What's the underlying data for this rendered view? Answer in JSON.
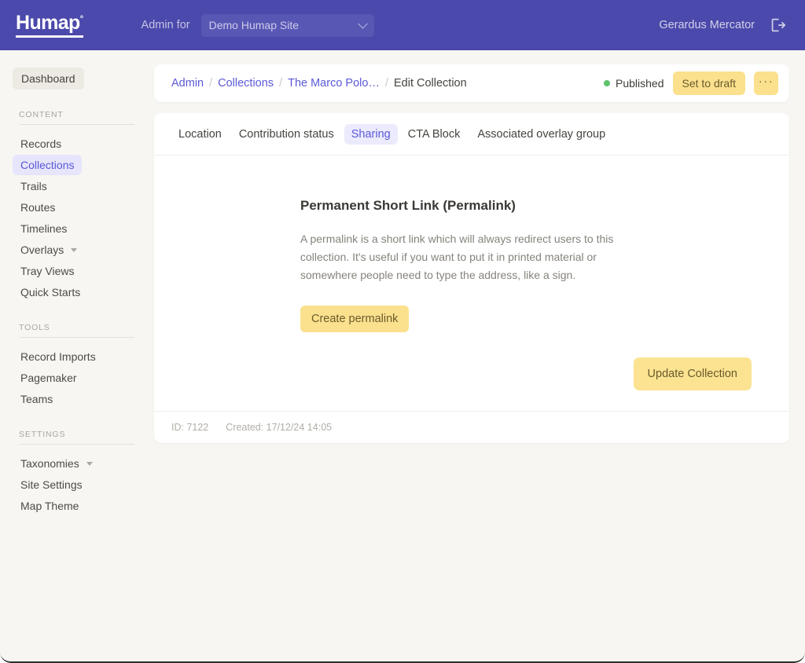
{
  "navbar": {
    "logo_text": "Humap",
    "logo_mark": "°",
    "admin_for_label": "Admin for",
    "site_select_value": "Demo Humap Site",
    "site_select_options": [
      "Demo Humap Site"
    ],
    "username": "Gerardus Mercator",
    "logout_icon": "logout-icon",
    "brand_color": "#4b49ab"
  },
  "sidebar": {
    "dashboard_label": "Dashboard",
    "groups": [
      {
        "title": "CONTENT",
        "items": [
          {
            "label": "Records",
            "active": false,
            "caret": false
          },
          {
            "label": "Collections",
            "active": true,
            "caret": false
          },
          {
            "label": "Trails",
            "active": false,
            "caret": false
          },
          {
            "label": "Routes",
            "active": false,
            "caret": false
          },
          {
            "label": "Timelines",
            "active": false,
            "caret": false
          },
          {
            "label": "Overlays",
            "active": false,
            "caret": true
          },
          {
            "label": "Tray Views",
            "active": false,
            "caret": false
          },
          {
            "label": "Quick Starts",
            "active": false,
            "caret": false
          }
        ]
      },
      {
        "title": "TOOLS",
        "items": [
          {
            "label": "Record Imports",
            "active": false,
            "caret": false
          },
          {
            "label": "Pagemaker",
            "active": false,
            "caret": false
          },
          {
            "label": "Teams",
            "active": false,
            "caret": false
          }
        ]
      },
      {
        "title": "SETTINGS",
        "items": [
          {
            "label": "Taxonomies",
            "active": false,
            "caret": true
          },
          {
            "label": "Site Settings",
            "active": false,
            "caret": false
          },
          {
            "label": "Map Theme",
            "active": false,
            "caret": false
          }
        ]
      }
    ]
  },
  "breadcrumb": {
    "items": [
      {
        "label": "Admin",
        "current": false
      },
      {
        "label": "Collections",
        "current": false
      },
      {
        "label": "The Marco Polo…",
        "current": false
      },
      {
        "label": "Edit Collection",
        "current": true
      }
    ],
    "separator": "/",
    "status_label": "Published",
    "status_color": "#5bc46a",
    "set_to_draft_label": "Set to draft",
    "more_label": "···"
  },
  "tabs": [
    {
      "label": "Location",
      "active": false
    },
    {
      "label": "Contribution status",
      "active": false
    },
    {
      "label": "Sharing",
      "active": true
    },
    {
      "label": "CTA Block",
      "active": false
    },
    {
      "label": "Associated overlay group",
      "active": false
    }
  ],
  "panel": {
    "section_title": "Permanent Short Link (Permalink)",
    "section_desc": "A permalink is a short link which will always redirect users to this collection. It's useful if you want to put it in printed material or somewhere people need to type the address, like a sign.",
    "create_permalink_label": "Create permalink",
    "update_collection_label": "Update Collection",
    "footer_id": "ID: 7122",
    "footer_created": "Created: 17/12/24 14:05"
  }
}
